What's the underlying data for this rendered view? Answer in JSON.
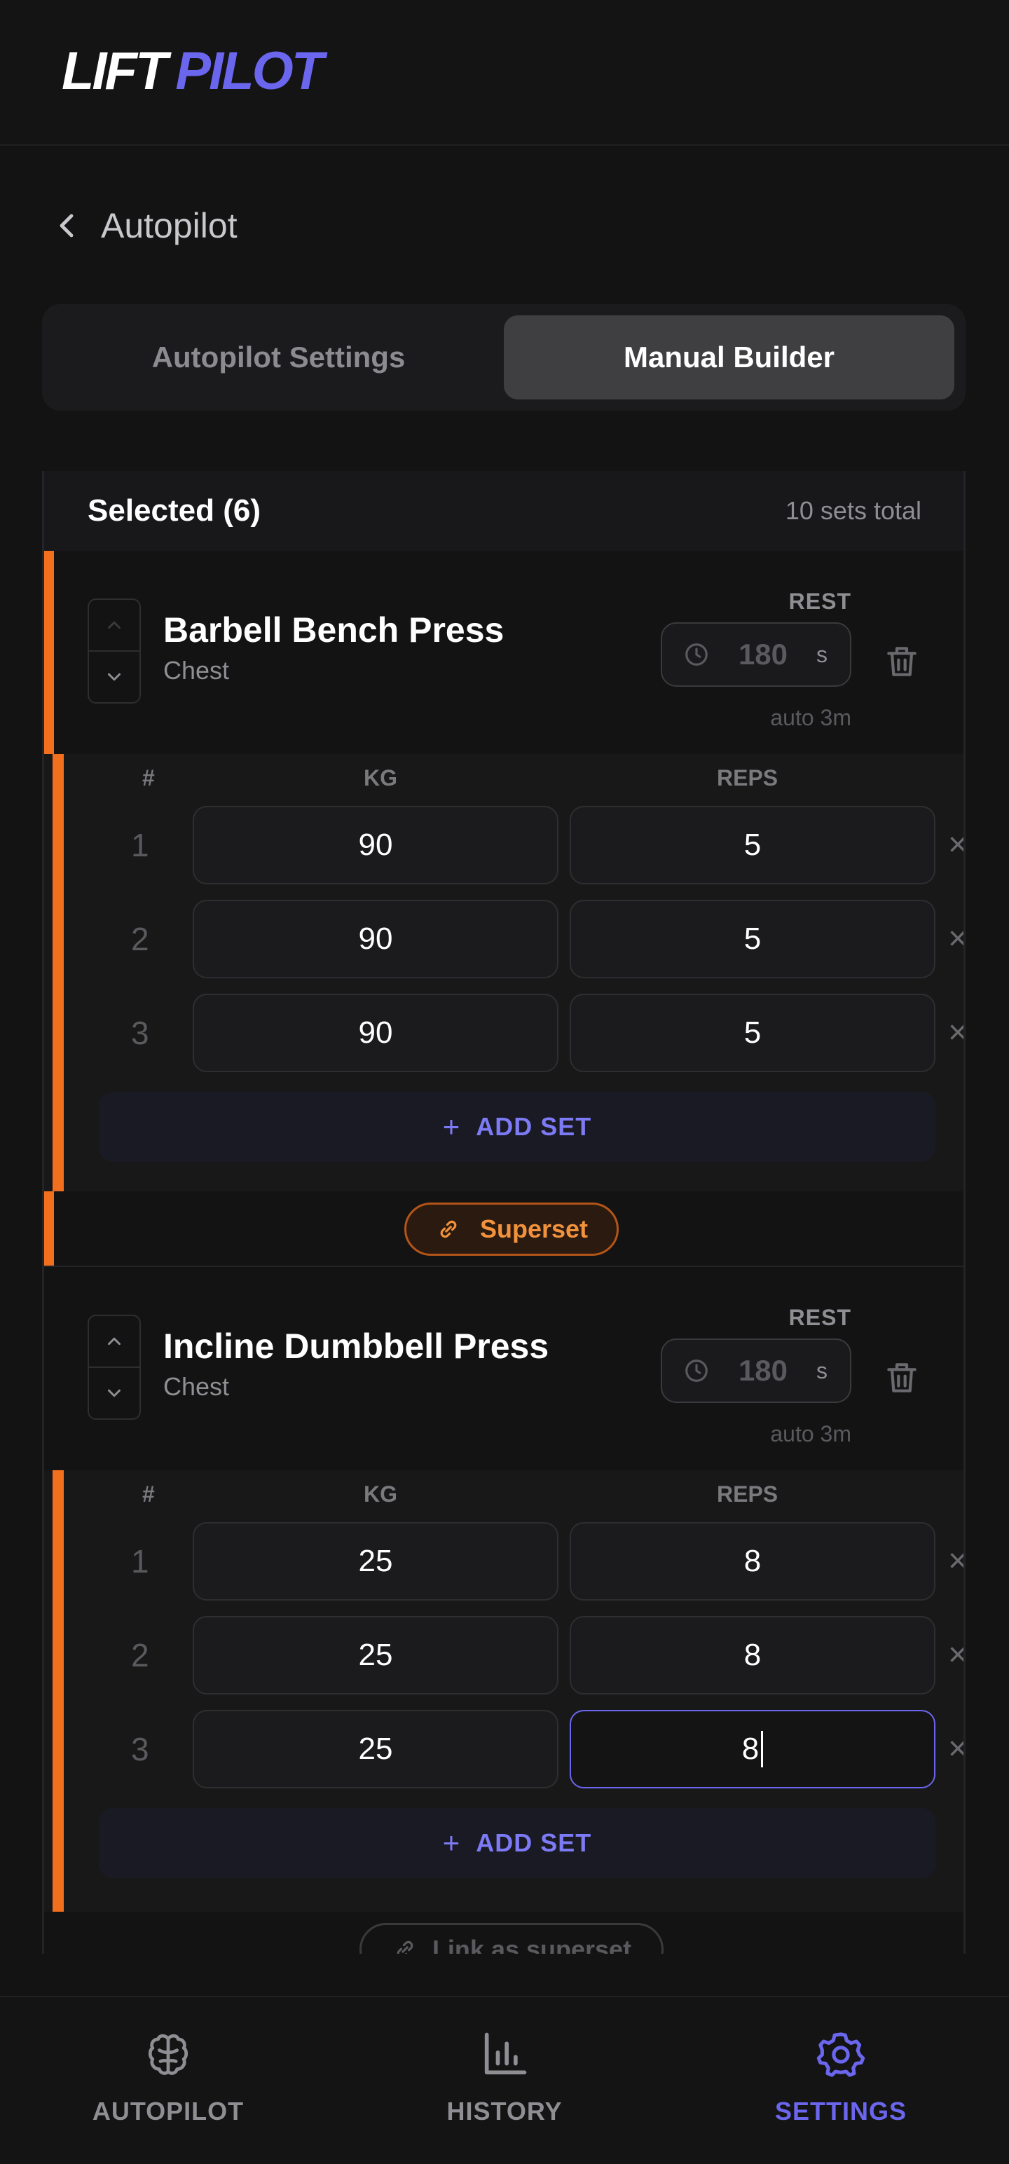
{
  "app": {
    "logo_part1": "LIFT",
    "logo_part2": "PILOT",
    "brand_color": "#6b66ee",
    "accent_color": "#f26f1d"
  },
  "page": {
    "back_label": "Autopilot"
  },
  "tabs": [
    {
      "label": "Autopilot Settings",
      "active": false
    },
    {
      "label": "Manual Builder",
      "active": true
    }
  ],
  "selection": {
    "title": "Selected (6)",
    "total": "10 sets total"
  },
  "columns": {
    "index": "#",
    "kg": "KG",
    "reps": "REPS"
  },
  "exercises": [
    {
      "name": "Barbell Bench Press",
      "group": "Chest",
      "rest_label": "REST",
      "rest_value": "180",
      "rest_unit": "s",
      "rest_auto": "auto 3m",
      "sets": [
        {
          "n": "1",
          "kg": "90",
          "reps": "5"
        },
        {
          "n": "2",
          "kg": "90",
          "reps": "5"
        },
        {
          "n": "3",
          "kg": "90",
          "reps": "5"
        }
      ],
      "add_set": "ADD SET"
    },
    {
      "name": "Incline Dumbbell Press",
      "group": "Chest",
      "rest_label": "REST",
      "rest_value": "180",
      "rest_unit": "s",
      "rest_auto": "auto 3m",
      "sets": [
        {
          "n": "1",
          "kg": "25",
          "reps": "8"
        },
        {
          "n": "2",
          "kg": "25",
          "reps": "8"
        },
        {
          "n": "3",
          "kg": "25",
          "reps": "8"
        }
      ],
      "add_set": "ADD SET"
    }
  ],
  "superset_label": "Superset",
  "link_superset_label": "Link as superset",
  "remove_glyph": "×",
  "plus_glyph": "+",
  "nav": [
    {
      "label": "AUTOPILOT",
      "icon": "brain-icon",
      "active": false
    },
    {
      "label": "HISTORY",
      "icon": "bar-chart-icon",
      "active": false
    },
    {
      "label": "SETTINGS",
      "icon": "gear-icon",
      "active": true
    }
  ]
}
